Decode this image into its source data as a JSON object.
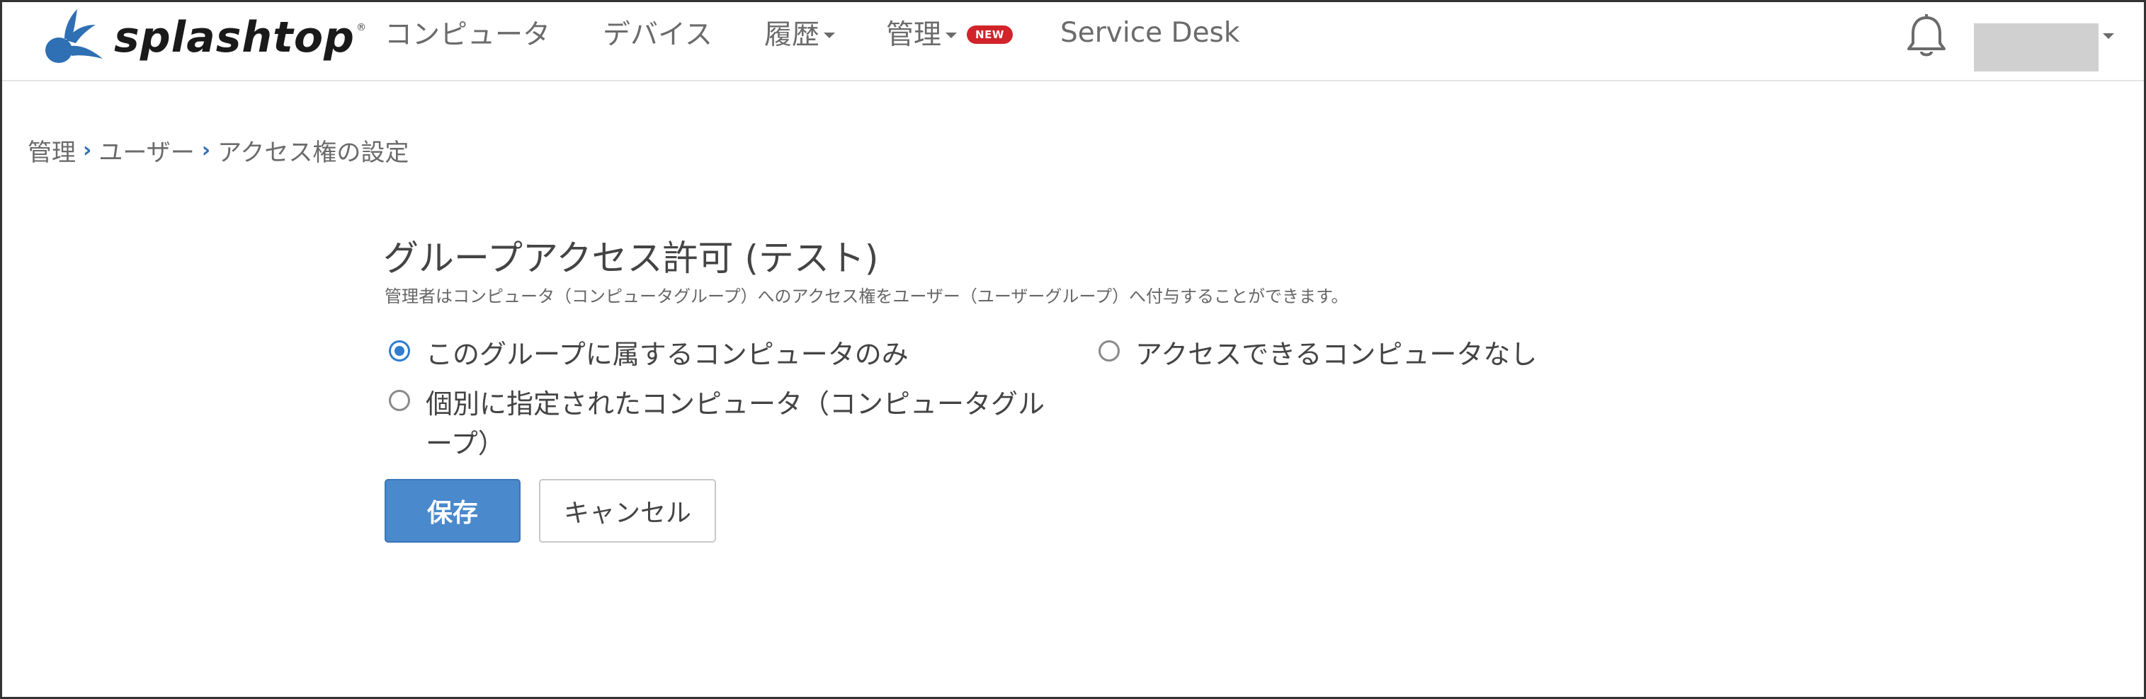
{
  "brand": {
    "name": "splashtop",
    "tm": "®",
    "logo_color": "#2f6fb3"
  },
  "nav": {
    "items": [
      {
        "label": "コンピュータ",
        "icon": ""
      },
      {
        "label": "デバイス",
        "icon": ""
      },
      {
        "label": "履歴",
        "icon": "chevron-down-icon"
      },
      {
        "label": "管理",
        "icon": "chevron-down-icon",
        "badge": "NEW"
      },
      {
        "label": "Service Desk",
        "icon": ""
      }
    ],
    "notification_icon": "bell-icon",
    "badge_color": "#d2232a"
  },
  "breadcrumb": {
    "items": [
      "管理",
      "ユーザー",
      "アクセス権の設定"
    ],
    "separator": "›"
  },
  "panel": {
    "title": "グループアクセス許可 (テスト)",
    "description": "管理者はコンピュータ（コンピュータグループ）へのアクセス権をユーザー（ユーザーグループ）へ付与することができます。",
    "options": [
      {
        "label": "このグループに属するコンピュータのみ",
        "checked": true
      },
      {
        "label": "アクセスできるコンピュータなし",
        "checked": false
      },
      {
        "label_line1": "個別に指定されたコンピュータ（コンピュータグル",
        "label_line2": "ープ）",
        "checked": false
      }
    ],
    "save_label": "保存",
    "cancel_label": "キャンセル",
    "accent_color": "#4a89cc"
  }
}
